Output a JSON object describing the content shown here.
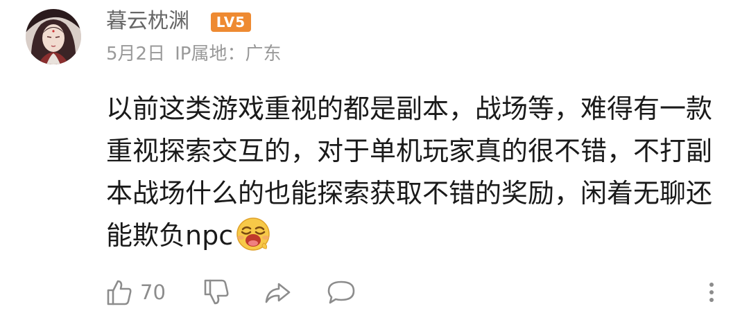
{
  "comment": {
    "author": {
      "name": "暮云枕渊",
      "level": "LV5"
    },
    "meta": {
      "date": "5月2日",
      "ip_location": "IP属地：广东"
    },
    "text": "以前这类游戏重视的都是副本，战场等，难得有一款重视探索交互的，对于单机玩家真的很不错，不打副本战场什么的也能探索获取不错的奖励，闲着无聊还能欺负npc",
    "emoji": "laughing-emoji",
    "actions": {
      "like_count": "70",
      "like_icon": "thumbs-up-icon",
      "dislike_icon": "thumbs-down-icon",
      "share_icon": "share-icon",
      "comment_icon": "comment-icon",
      "more_icon": "more-icon"
    }
  },
  "colors": {
    "badge": "#ee8a32",
    "name": "#666666",
    "meta": "#999999",
    "text": "#1a1a1a",
    "icon": "#8c8c8c"
  }
}
